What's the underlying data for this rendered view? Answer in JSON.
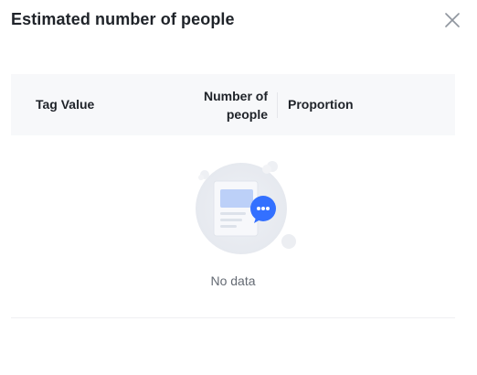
{
  "dialog": {
    "title": "Estimated number of people",
    "close_icon": "close-icon"
  },
  "table": {
    "columns": [
      {
        "key": "tag_value",
        "label": "Tag Value"
      },
      {
        "key": "people",
        "label": "Number of people"
      },
      {
        "key": "proportion",
        "label": "Proportion"
      }
    ],
    "people_label_line1": "Number of",
    "people_label_line2": "people",
    "rows": [],
    "empty_text": "No data",
    "empty_icon": "empty-document-chat-illustration"
  },
  "colors": {
    "header_bg": "#f7f8fa",
    "accent": "#3370ff",
    "text": "#1f2329",
    "muted_text": "#646a73"
  }
}
